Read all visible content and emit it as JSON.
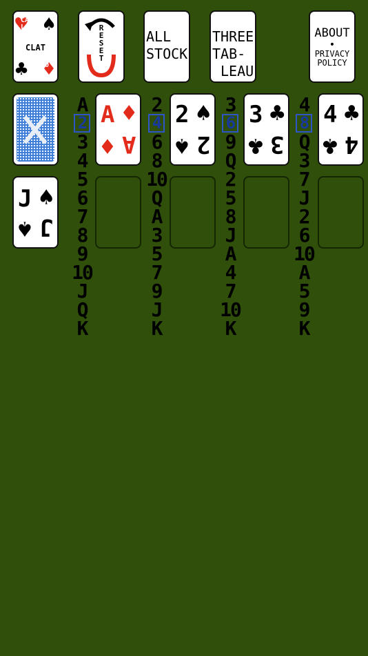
{
  "buttons": {
    "game_logo": {
      "line1": "CAL",
      "line2": "CLAT",
      "line3": "ION"
    },
    "reset": {
      "label": "RESET"
    },
    "all_stock": {
      "line1": "ALL",
      "line2": "STOCK"
    },
    "three_tableau": {
      "line1": "THREE",
      "line2": "TAB-",
      "line3": "LEAU"
    },
    "about": {
      "line1": "ABOUT",
      "line2": "•",
      "line3": "PRIVACY",
      "line4": "POLICY"
    }
  },
  "waste_card": {
    "rank": "J",
    "suit": "♠"
  },
  "sequences": [
    {
      "ranks": [
        "A",
        "2",
        "3",
        "4",
        "5",
        "6",
        "7",
        "8",
        "9",
        "10",
        "J",
        "Q",
        "K"
      ],
      "next_index": 1
    },
    {
      "ranks": [
        "2",
        "4",
        "6",
        "8",
        "10",
        "Q",
        "A",
        "3",
        "5",
        "7",
        "9",
        "J",
        "K"
      ],
      "next_index": 1
    },
    {
      "ranks": [
        "3",
        "6",
        "9",
        "Q",
        "2",
        "5",
        "8",
        "J",
        "A",
        "4",
        "7",
        "10",
        "K"
      ],
      "next_index": 1
    },
    {
      "ranks": [
        "4",
        "8",
        "Q",
        "3",
        "7",
        "J",
        "2",
        "6",
        "10",
        "A",
        "5",
        "9",
        "K"
      ],
      "next_index": 1
    }
  ],
  "foundations": [
    {
      "rank": "A",
      "suit": "♦",
      "color": "#e32b1c"
    },
    {
      "rank": "2",
      "suit": "♠",
      "color": "#000000"
    },
    {
      "rank": "3",
      "suit": "♣",
      "color": "#000000"
    },
    {
      "rank": "4",
      "suit": "♣",
      "color": "#000000"
    }
  ],
  "colors": {
    "felt": "#2f4f0b",
    "highlight": "#2f56c8",
    "card_back": "#3f7fd8",
    "red": "#e32b1c"
  }
}
